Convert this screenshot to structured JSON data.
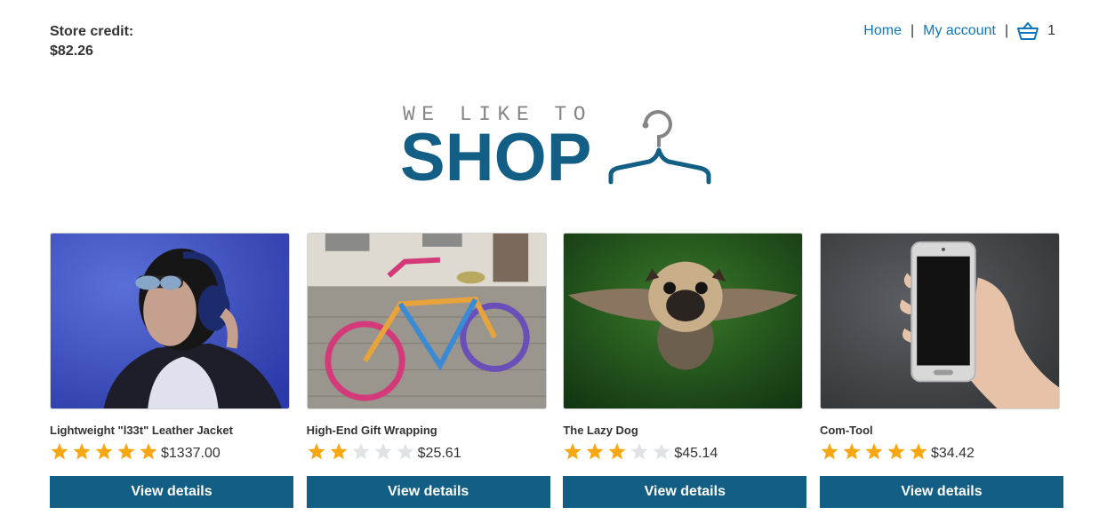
{
  "header": {
    "store_credit_label": "Store credit:",
    "store_credit_amount": "$82.26",
    "nav": {
      "home": "Home",
      "separator": "|",
      "my_account": "My account",
      "cart_count": "1"
    }
  },
  "logo": {
    "tagline": "WE LIKE TO",
    "word": "SHOP"
  },
  "colors": {
    "link": "#0e76bc",
    "brand": "#135e84",
    "star_on": "#f7a712",
    "star_off": "#dfe3e6"
  },
  "products": [
    {
      "name": "Lightweight \"l33t\" Leather Jacket",
      "rating": 5,
      "price": "$1337.00",
      "button": "View details",
      "image_icon": "woman-headphones-photo"
    },
    {
      "name": "High-End Gift Wrapping",
      "rating": 2,
      "price": "$25.61",
      "button": "View details",
      "image_icon": "knitted-bicycle-photo"
    },
    {
      "name": "The Lazy Dog",
      "rating": 3,
      "price": "$45.14",
      "button": "View details",
      "image_icon": "flying-pug-photo"
    },
    {
      "name": "Com-Tool",
      "rating": 5,
      "price": "$34.42",
      "button": "View details",
      "image_icon": "hand-phone-photo"
    }
  ]
}
